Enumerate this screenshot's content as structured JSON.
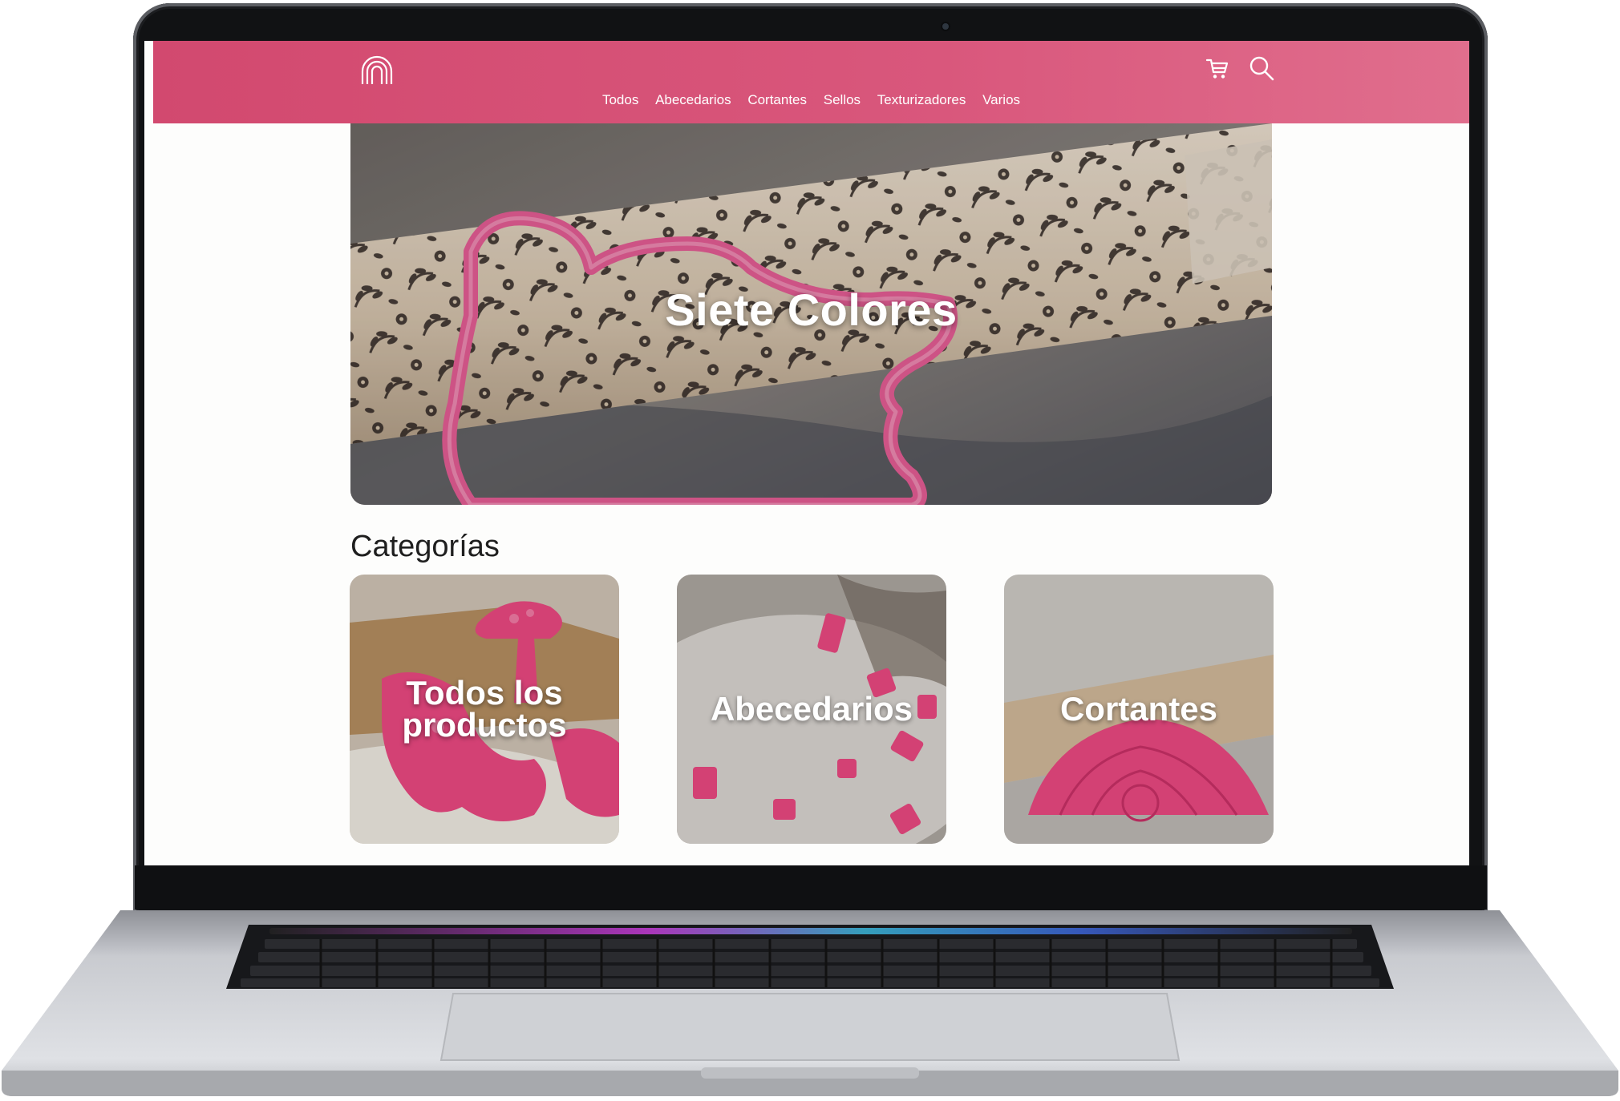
{
  "site": {
    "brand_color": "#d9577c",
    "logo": "rainbow-logo",
    "nav": [
      "Todos",
      "Abecedarios",
      "Cortantes",
      "Sellos",
      "Texturizadores",
      "Varios"
    ],
    "icons": [
      "cart-icon",
      "search-icon"
    ]
  },
  "hero": {
    "title": "Siete Colores"
  },
  "categories": {
    "heading": "Categorías",
    "items": [
      {
        "label_line1": "Todos los",
        "label_line2": "productos"
      },
      {
        "label_line1": "Abecedarios",
        "label_line2": ""
      },
      {
        "label_line1": "Cortantes",
        "label_line2": ""
      }
    ]
  },
  "colors": {
    "accent_pink": "#e2447b",
    "header_pink": "#d9577c"
  }
}
